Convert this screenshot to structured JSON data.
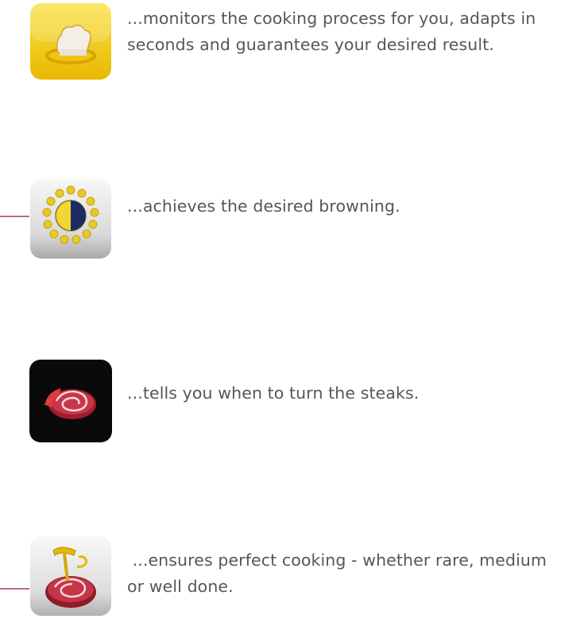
{
  "features": [
    {
      "text": "...monitors the cooking process for you, adapts in seconds and guarantees your desired result.",
      "icon": "chef-hat-icon"
    },
    {
      "text": "...achieves the desired browning.",
      "icon": "browning-level-icon"
    },
    {
      "text": "...tells you when to turn the steaks.",
      "icon": "turn-steak-icon"
    },
    {
      "text": " ...ensures perfect cooking - whether rare, medium or well done.",
      "icon": "cooking-probe-icon"
    }
  ],
  "colors": {
    "text": "#55565a",
    "connector": "#c06a74",
    "accent_yellow": "#f3c80f"
  }
}
